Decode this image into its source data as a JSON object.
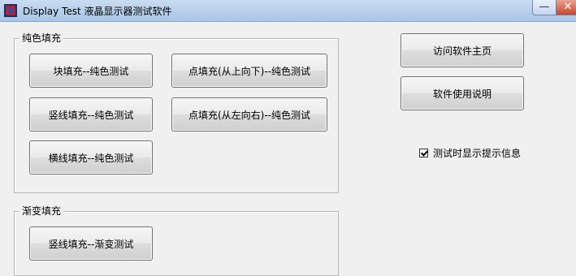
{
  "window": {
    "title": "Display Test 液晶显示器测试软件",
    "minimize_glyph": "—",
    "close_glyph": "✕"
  },
  "solid_group": {
    "label": "纯色填充",
    "buttons": [
      {
        "label": "块填充--纯色测试"
      },
      {
        "label": "点填充(从上向下)--纯色测试"
      },
      {
        "label": "竖线填充--纯色测试"
      },
      {
        "label": "点填充(从左向右)--纯色测试"
      },
      {
        "label": "横线填充--纯色测试"
      }
    ]
  },
  "gradient_group": {
    "label": "渐变填充",
    "buttons": [
      {
        "label": "竖线填充--渐变测试"
      }
    ]
  },
  "side": {
    "homepage_button": "访问软件主页",
    "help_button": "软件使用说明",
    "show_tips_label": "测试时显示提示信息",
    "show_tips_checked": true
  }
}
